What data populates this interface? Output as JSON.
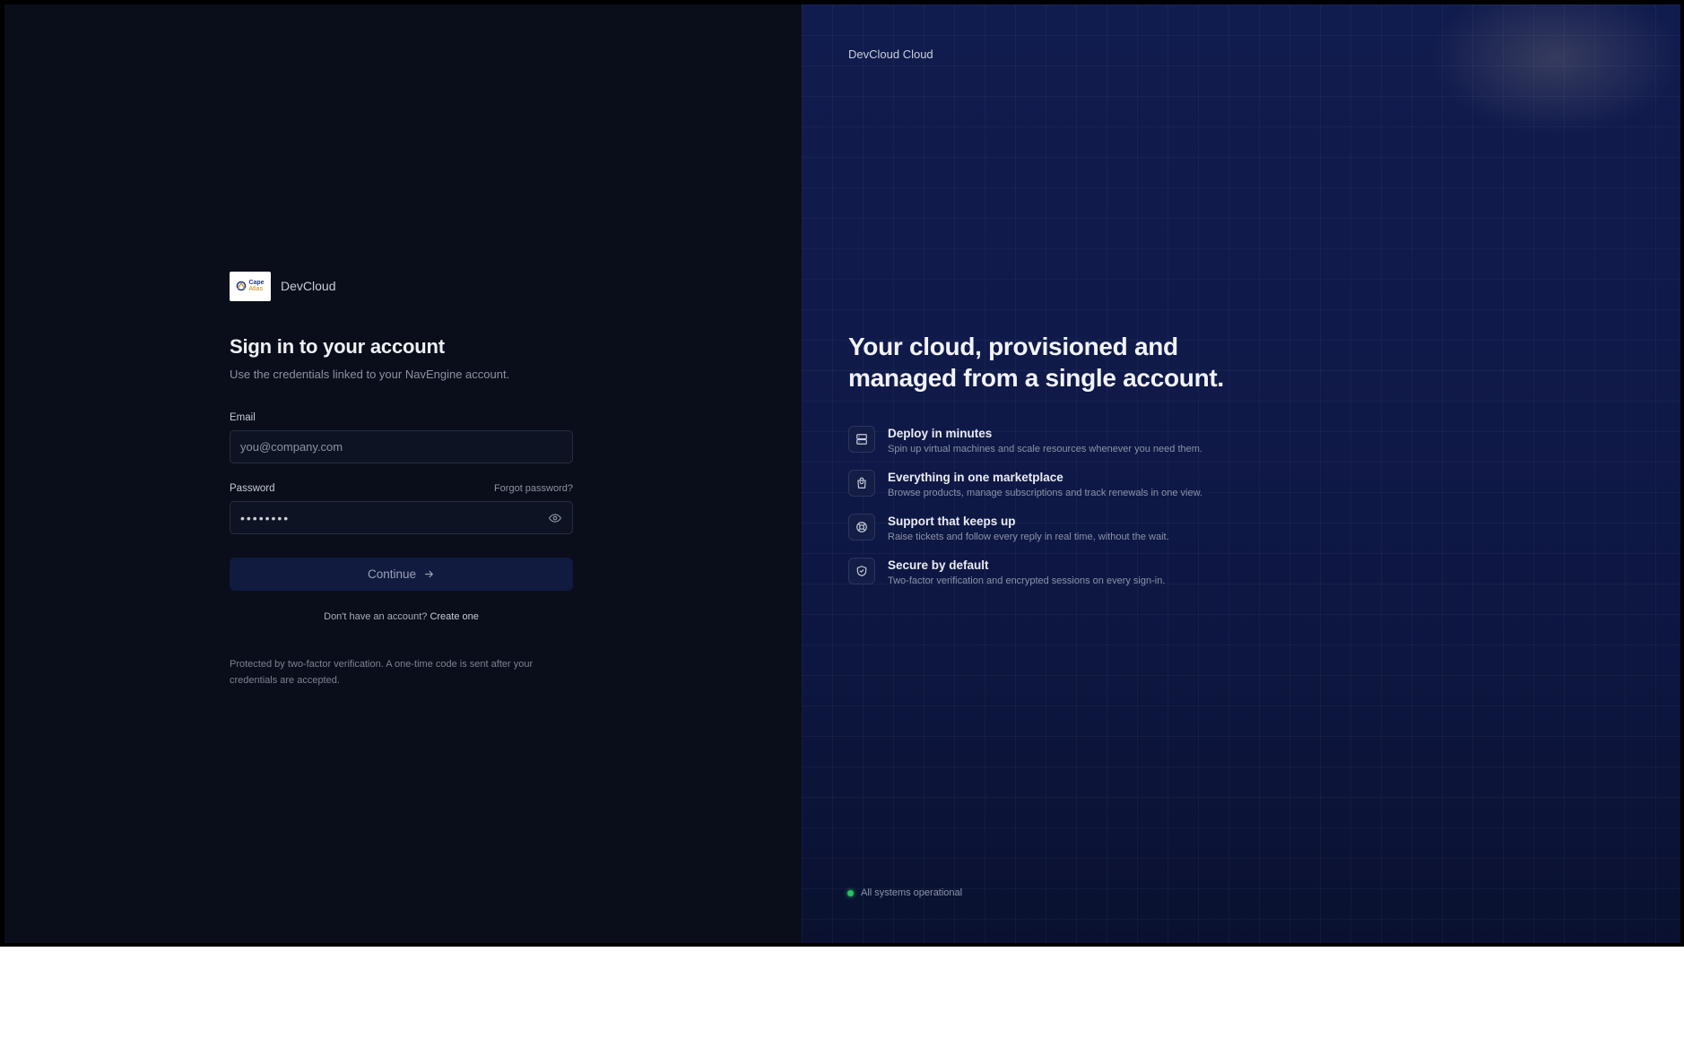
{
  "left": {
    "brand_name": "DevCloud",
    "logo_line1": "Cape",
    "logo_line2": "Atlas",
    "title": "Sign in to your account",
    "subtitle": "Use the credentials linked to your NavEngine account.",
    "email_label": "Email",
    "email_placeholder": "you@company.com",
    "password_label": "Password",
    "forgot_label": "Forgot password?",
    "password_value": "••••••••",
    "continue_label": "Continue",
    "signup_prompt": "Don't have an account?",
    "signup_link": "Create one",
    "note": "Protected by two-factor verification. A one-time code is sent after your credentials are accepted."
  },
  "right": {
    "brand": "DevCloud Cloud",
    "headline": "Your cloud, provisioned and managed from a single account.",
    "features": [
      {
        "icon": "server-icon",
        "title": "Deploy in minutes",
        "desc": "Spin up virtual machines and scale resources whenever you need them."
      },
      {
        "icon": "shopping-bag-icon",
        "title": "Everything in one marketplace",
        "desc": "Browse products, manage subscriptions and track renewals in one view."
      },
      {
        "icon": "lifebuoy-icon",
        "title": "Support that keeps up",
        "desc": "Raise tickets and follow every reply in real time, without the wait."
      },
      {
        "icon": "shield-check-icon",
        "title": "Secure by default",
        "desc": "Two-factor verification and encrypted sessions on every sign-in."
      }
    ],
    "status": "All systems operational",
    "status_color": "#22c55e"
  }
}
